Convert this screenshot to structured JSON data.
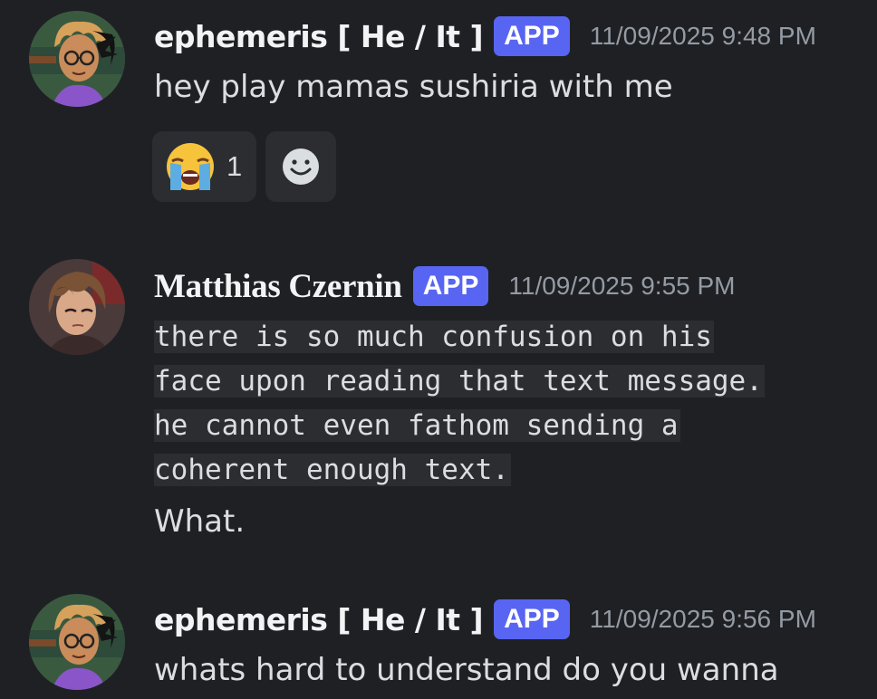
{
  "messages": [
    {
      "username": "ephemeris [ He / It ]",
      "badge": "APP",
      "timestamp": "11/09/2025 9:48 PM",
      "text": "hey play mamas sushiria with me",
      "reactions": [
        {
          "emoji": "loudly-crying-face",
          "count": "1"
        }
      ],
      "avatar_icon": "curly-haired-character-avatar"
    },
    {
      "username": "Matthias Czernin",
      "badge": "APP",
      "timestamp": "11/09/2025 9:55 PM",
      "code_lines": [
        "there is so much confusion on his",
        "face upon reading that text message.",
        "he cannot even fathom sending a",
        "coherent enough text."
      ],
      "text": "What.",
      "avatar_icon": "brown-haired-character-avatar"
    },
    {
      "username": "ephemeris [ He / It ]",
      "badge": "APP",
      "timestamp": "11/09/2025 9:56 PM",
      "text": "whats hard to understand do you wanna",
      "avatar_icon": "curly-haired-character-avatar"
    }
  ],
  "colors": {
    "background": "#1f2024",
    "badge": "#5865f2",
    "username": "#f2f3f5",
    "timestamp": "#949ba4",
    "text": "#dbdee1",
    "reaction_bg": "#2b2d31"
  },
  "icons": {
    "add_reaction": "smiley-add-reaction-icon"
  }
}
